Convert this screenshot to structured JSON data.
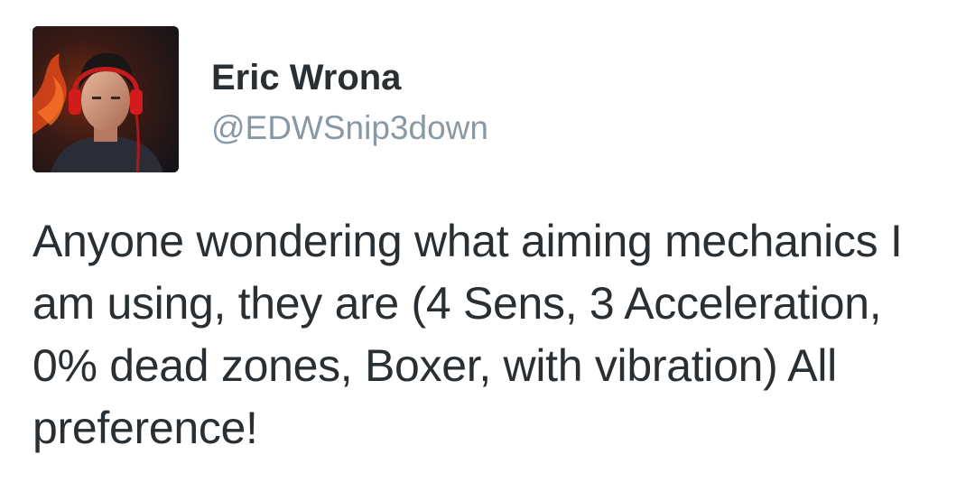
{
  "tweet": {
    "author": {
      "display_name": "Eric Wrona",
      "handle": "@EDWSnip3down",
      "avatar_icon": "profile-photo-avatar"
    },
    "text_lines": [
      "Anyone wondering what aiming mechanics I",
      "am using, they are (4 Sens, 3 Acceleration,",
      "0% dead zones, Boxer, with vibration) All",
      "preference!"
    ]
  },
  "colors": {
    "name": "#292f33",
    "handle": "#8899a6",
    "text": "#292f33",
    "background": "#ffffff",
    "headset_accent": "#d21b1b"
  }
}
